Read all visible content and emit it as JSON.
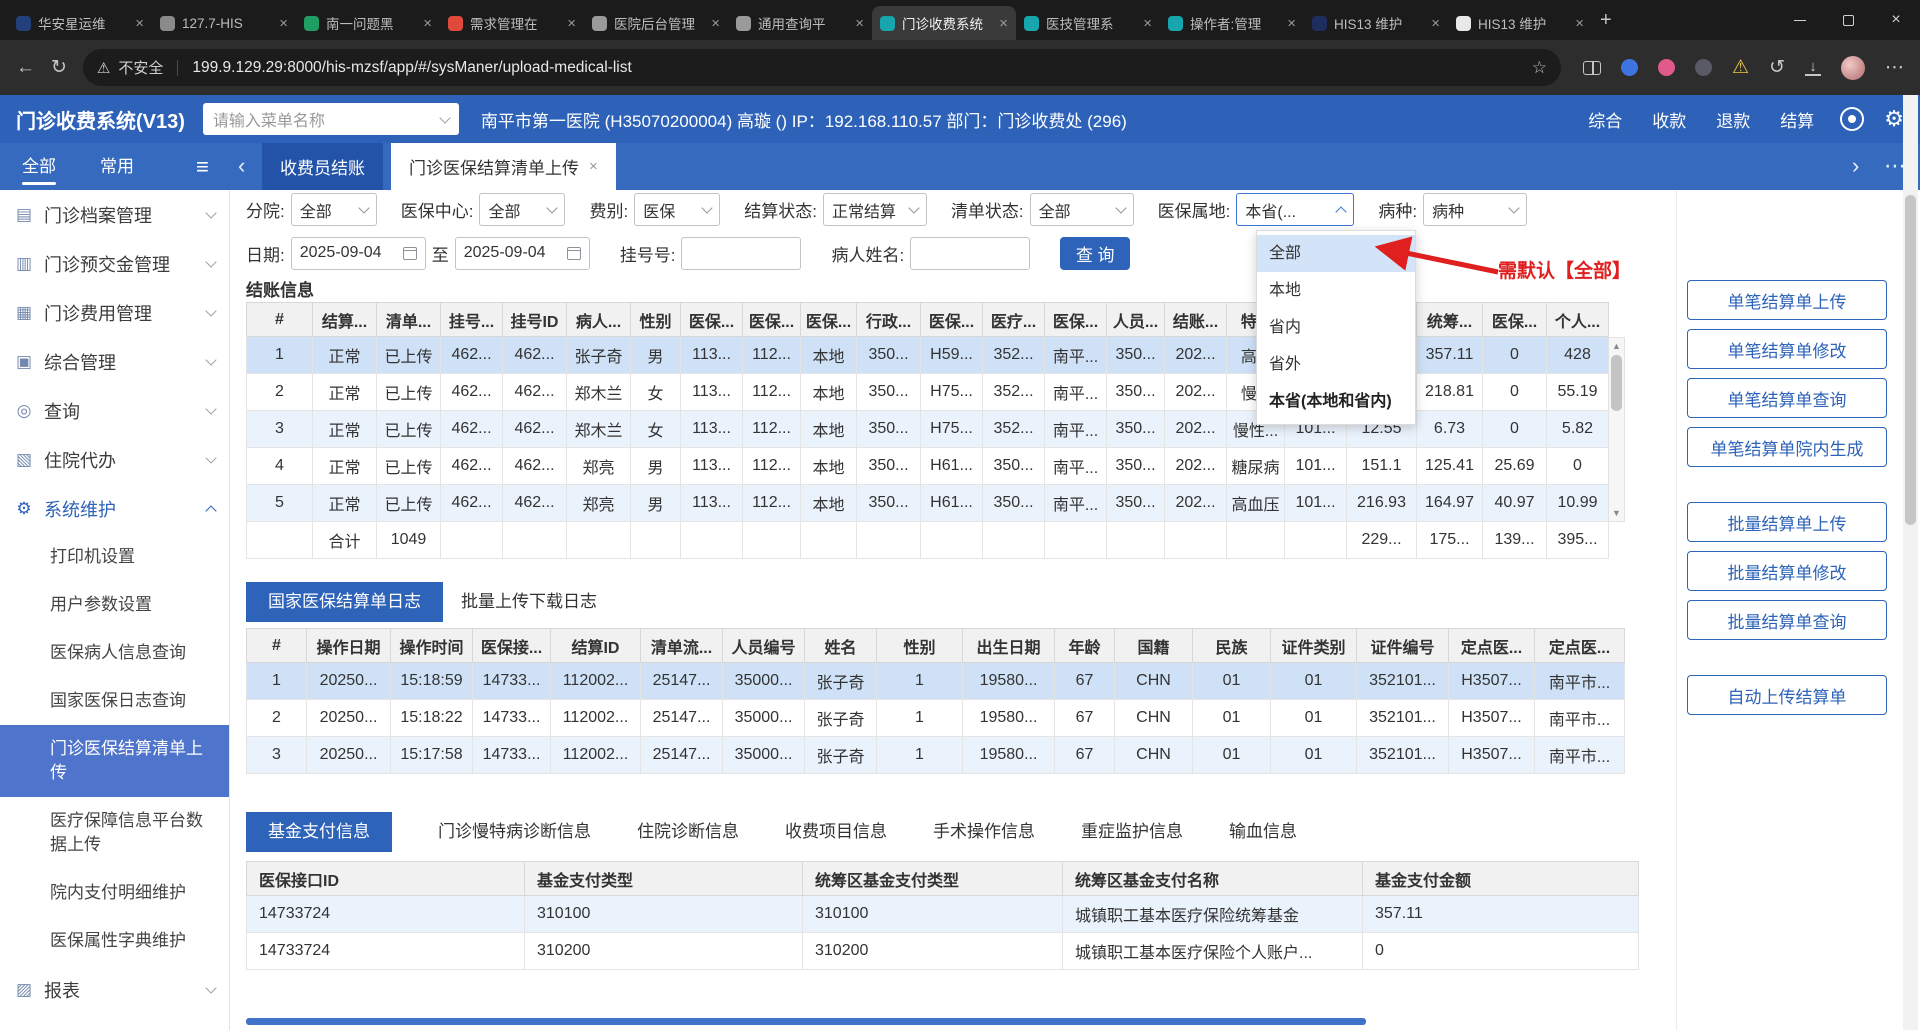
{
  "colors": {
    "accent": "#2d63b8",
    "annotation_red": "#e01f1f",
    "row_selected": "#cfe1f7",
    "row_alt": "#eaf2fc"
  },
  "icons": {
    "back": "←",
    "refresh": "↻",
    "warning": "⚠",
    "star": "☆",
    "history": "↺",
    "download": "↓",
    "more": "⋯",
    "menu": "≡",
    "chev_left": "‹",
    "chev_right": "›",
    "new_tab": "+",
    "close": "×",
    "gear": "⚙",
    "arrow_up": "▲",
    "arrow_down": "▼"
  },
  "browser": {
    "tabs": [
      {
        "title": "华安星运维",
        "color": "#23407a",
        "active": false
      },
      {
        "title": "127.7-HIS",
        "color": "#8a8a8a",
        "active": false
      },
      {
        "title": "南一问题黑",
        "color": "#1e9e62",
        "active": false
      },
      {
        "title": "需求管理在",
        "color": "#e04a3a",
        "active": false
      },
      {
        "title": "医院后台管理",
        "color": "#9a9a9a",
        "active": false
      },
      {
        "title": "通用查询平",
        "color": "#9a9a9a",
        "active": false
      },
      {
        "title": "门诊收费系统",
        "color": "#18a5ad",
        "active": true
      },
      {
        "title": "医技管理系",
        "color": "#18a5ad",
        "active": false
      },
      {
        "title": "操作者:管理",
        "color": "#18a5ad",
        "active": false
      },
      {
        "title": "HIS13 维护",
        "color": "#1d2e5e",
        "active": false
      },
      {
        "title": "HIS13 维护",
        "color": "#e8e8e8",
        "active": false
      }
    ],
    "security_label": "不安全",
    "url": "199.9.129.29:8000/his-mzsf/app/#/sysManer/upload-medical-list"
  },
  "app_header": {
    "title": "门诊收费系统(V13)",
    "menu_search_placeholder": "请输入菜单名称",
    "hospital_info": "南平市第一医院 (H35070200004) 高璇 () IP：192.168.110.57 部门：门诊收费处 (296)",
    "nav_links": [
      "综合",
      "收款",
      "退款",
      "结算"
    ]
  },
  "workspace_tabs": {
    "filter_tabs": [
      {
        "label": "全部",
        "active": true
      },
      {
        "label": "常用",
        "active": false
      }
    ],
    "open_tabs": [
      {
        "label": "收费员结账",
        "active": false,
        "closable": false
      },
      {
        "label": "门诊医保结算清单上传",
        "active": true,
        "closable": true
      }
    ]
  },
  "sidebar": {
    "menus": [
      {
        "label": "门诊档案管理",
        "glyph": "▤",
        "expanded": false
      },
      {
        "label": "门诊预交金管理",
        "glyph": "▥",
        "expanded": false
      },
      {
        "label": "门诊费用管理",
        "glyph": "▦",
        "expanded": false
      },
      {
        "label": "综合管理",
        "glyph": "▣",
        "expanded": false
      },
      {
        "label": "查询",
        "glyph": "◎",
        "expanded": false
      },
      {
        "label": "住院代办",
        "glyph": "▧",
        "expanded": false
      },
      {
        "label": "系统维护",
        "glyph": "⚙",
        "expanded": true,
        "children": [
          "打印机设置",
          "用户参数设置",
          "医保病人信息查询",
          "国家医保日志查询",
          "门诊医保结算清单上传",
          "医疗保障信息平台数据上传",
          "院内支付明细维护",
          "医保属性字典维护"
        ],
        "active_child": "门诊医保结算清单上传"
      },
      {
        "label": "报表",
        "glyph": "▨",
        "expanded": false
      }
    ]
  },
  "filters": {
    "row1": [
      {
        "label": "分院:",
        "value": "全部",
        "open": false
      },
      {
        "label": "医保中心:",
        "value": "全部",
        "open": false
      },
      {
        "label": "费别:",
        "value": "医保",
        "open": false
      },
      {
        "label": "结算状态:",
        "value": "正常结算",
        "open": false
      },
      {
        "label": "清单状态:",
        "value": "全部",
        "open": false
      },
      {
        "label": "医保属地:",
        "value": "本省(...",
        "open": true
      },
      {
        "label": "病种:",
        "value": "病种",
        "open": false
      }
    ],
    "date_label": "日期:",
    "date_from": "2025-09-04",
    "date_to_sep": "至",
    "date_to": "2025-09-04",
    "regno_label": "挂号号:",
    "name_label": "病人姓名:",
    "search_button": "查 询"
  },
  "belong_dropdown": {
    "options": [
      {
        "label": "全部",
        "highlighted": true,
        "selected": false
      },
      {
        "label": "本地",
        "highlighted": false,
        "selected": false
      },
      {
        "label": "省内",
        "highlighted": false,
        "selected": false
      },
      {
        "label": "省外",
        "highlighted": false,
        "selected": false
      },
      {
        "label": "本省(本地和省内)",
        "highlighted": false,
        "selected": true
      }
    ]
  },
  "annotation": {
    "text": "需默认【全部】"
  },
  "settle_section": {
    "title": "结账信息",
    "headers": [
      "#",
      "结算...",
      "清单...",
      "挂号...",
      "挂号ID",
      "病人...",
      "性别",
      "医保...",
      "医保...",
      "医保...",
      "行政...",
      "医保...",
      "医疗...",
      "医保...",
      "人员...",
      "结账...",
      "特...",
      "",
      "",
      "统筹...",
      "医保...",
      "个人..."
    ],
    "rows": [
      [
        "1",
        "正常",
        "已上传",
        "462...",
        "462...",
        "张子奇",
        "男",
        "113...",
        "112...",
        "本地",
        "350...",
        "H59...",
        "352...",
        "南平...",
        "350...",
        "202...",
        "高...",
        "",
        "",
        "357.11",
        "0",
        "428"
      ],
      [
        "2",
        "正常",
        "已上传",
        "462...",
        "462...",
        "郑木兰",
        "女",
        "113...",
        "112...",
        "本地",
        "350...",
        "H75...",
        "352...",
        "南平...",
        "350...",
        "202...",
        "慢...",
        "",
        "",
        "218.81",
        "0",
        "55.19"
      ],
      [
        "3",
        "正常",
        "已上传",
        "462...",
        "462...",
        "郑木兰",
        "女",
        "113...",
        "112...",
        "本地",
        "350...",
        "H75...",
        "352...",
        "南平...",
        "350...",
        "202...",
        "慢性...",
        "101...",
        "12.55",
        "6.73",
        "0",
        "5.82"
      ],
      [
        "4",
        "正常",
        "已上传",
        "462...",
        "462...",
        "郑亮",
        "男",
        "113...",
        "112...",
        "本地",
        "350...",
        "H61...",
        "350...",
        "南平...",
        "350...",
        "202...",
        "糖尿病",
        "101...",
        "151.1",
        "125.41",
        "25.69",
        "0"
      ],
      [
        "5",
        "正常",
        "已上传",
        "462...",
        "462...",
        "郑亮",
        "男",
        "113...",
        "112...",
        "本地",
        "350...",
        "H61...",
        "350...",
        "南平...",
        "350...",
        "202...",
        "高血压",
        "101...",
        "216.93",
        "164.97",
        "40.97",
        "10.99"
      ]
    ],
    "total_row": [
      "",
      "合计",
      "1049",
      "",
      "",
      "",
      "",
      "",
      "",
      "",
      "",
      "",
      "",
      "",
      "",
      "",
      "",
      "",
      "229...",
      "175...",
      "139...",
      "395..."
    ]
  },
  "log_section": {
    "tabs": [
      {
        "label": "国家医保结算单日志",
        "active": true
      },
      {
        "label": "批量上传下载日志",
        "active": false
      }
    ],
    "headers": [
      "#",
      "操作日期",
      "操作时间",
      "医保接...",
      "结算ID",
      "清单流...",
      "人员编号",
      "姓名",
      "性别",
      "出生日期",
      "年龄",
      "国籍",
      "民族",
      "证件类别",
      "证件编号",
      "定点医...",
      "定点医..."
    ],
    "rows": [
      [
        "1",
        "20250...",
        "15:18:59",
        "14733...",
        "112002...",
        "25147...",
        "35000...",
        "张子奇",
        "1",
        "19580...",
        "67",
        "CHN",
        "01",
        "01",
        "352101...",
        "H3507...",
        "南平市..."
      ],
      [
        "2",
        "20250...",
        "15:18:22",
        "14733...",
        "112002...",
        "25147...",
        "35000...",
        "张子奇",
        "1",
        "19580...",
        "67",
        "CHN",
        "01",
        "01",
        "352101...",
        "H3507...",
        "南平市..."
      ],
      [
        "3",
        "20250...",
        "15:17:58",
        "14733...",
        "112002...",
        "25147...",
        "35000...",
        "张子奇",
        "1",
        "19580...",
        "67",
        "CHN",
        "01",
        "01",
        "352101...",
        "H3507...",
        "南平市..."
      ]
    ]
  },
  "fund_section": {
    "tabs": [
      {
        "label": "基金支付信息",
        "active": true
      },
      {
        "label": "门诊慢特病诊断信息",
        "active": false
      },
      {
        "label": "住院诊断信息",
        "active": false
      },
      {
        "label": "收费项目信息",
        "active": false
      },
      {
        "label": "手术操作信息",
        "active": false
      },
      {
        "label": "重症监护信息",
        "active": false
      },
      {
        "label": "输血信息",
        "active": false
      }
    ],
    "headers": [
      "医保接口ID",
      "基金支付类型",
      "统筹区基金支付类型",
      "统筹区基金支付名称",
      "基金支付金额"
    ],
    "rows": [
      [
        "14733724",
        "310100",
        "310100",
        "城镇职工基本医疗保险统筹基金",
        "357.11"
      ],
      [
        "14733724",
        "310200",
        "310200",
        "城镇职工基本医疗保险个人账户...",
        "0"
      ]
    ]
  },
  "right_panel": {
    "groups": [
      [
        "单笔结算单上传",
        "单笔结算单修改",
        "单笔结算单查询",
        "单笔结算单院内生成"
      ],
      [
        "批量结算单上传",
        "批量结算单修改",
        "批量结算单查询"
      ],
      [
        "自动上传结算单"
      ]
    ]
  }
}
